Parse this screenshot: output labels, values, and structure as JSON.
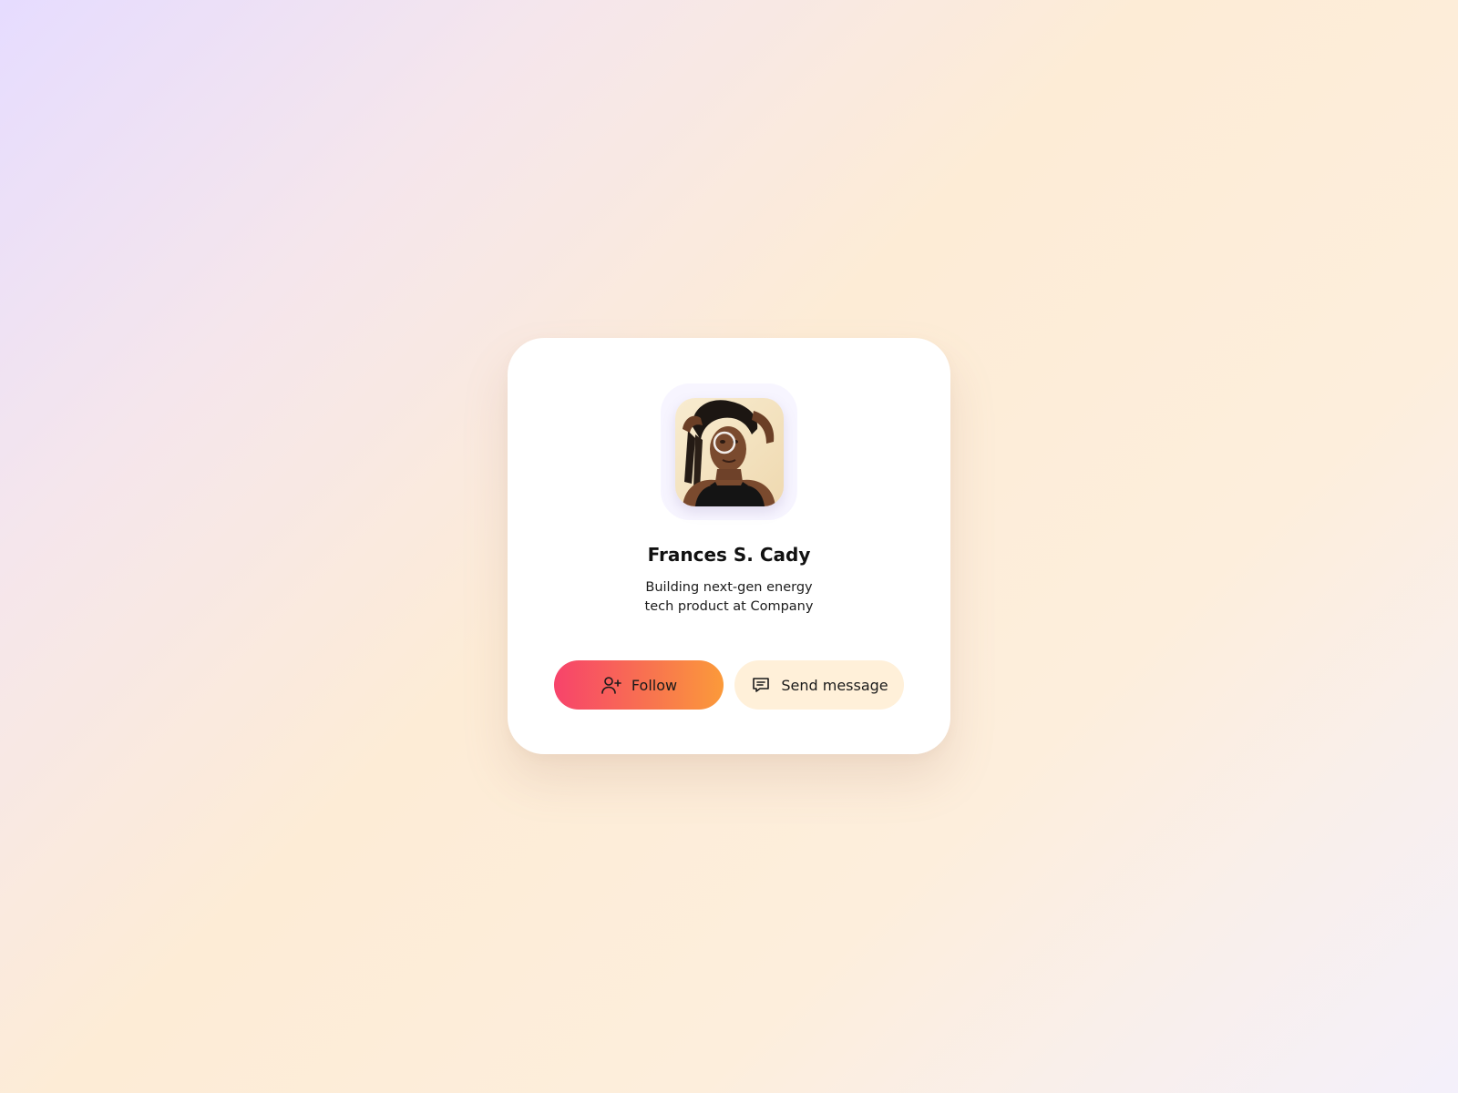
{
  "profile": {
    "name": "Frances S. Cady",
    "bio_line_1": "Building next-gen energy",
    "bio_line_2": "tech product at Company",
    "avatar_alt": "Frances S. Cady"
  },
  "actions": {
    "follow_label": "Follow",
    "follow_icon": "user-plus-icon",
    "message_label": "Send message",
    "message_icon": "message-icon"
  },
  "colors": {
    "follow_gradient_start": "#f7436b",
    "follow_gradient_end": "#fb9a3a",
    "message_bg": "#fff0d9",
    "card_bg": "#ffffff"
  }
}
